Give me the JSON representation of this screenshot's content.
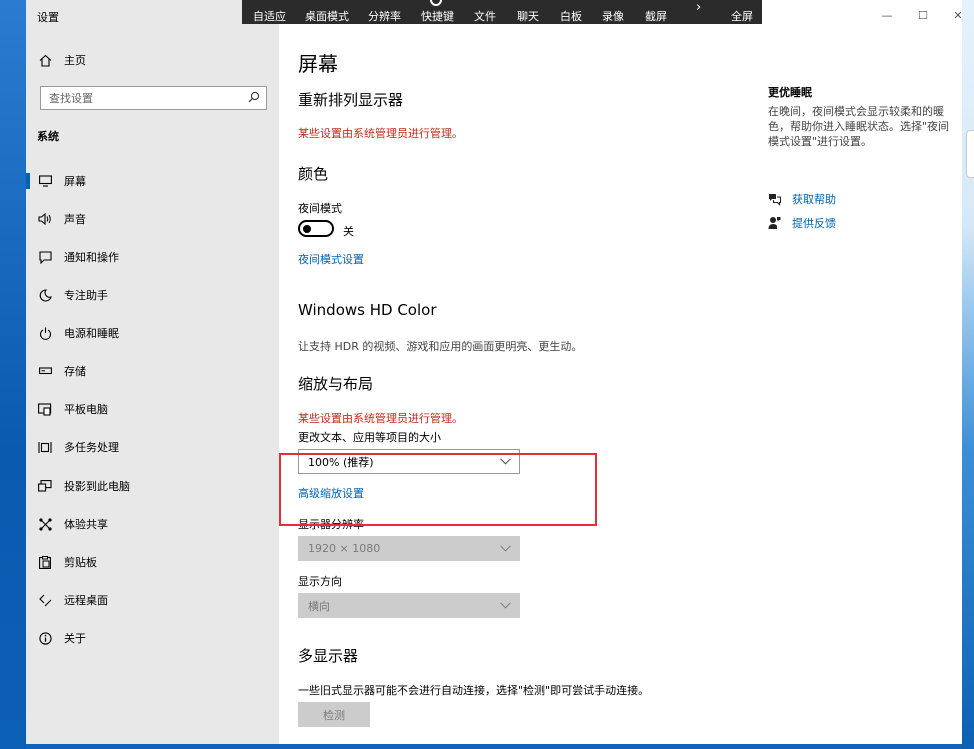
{
  "window": {
    "title": "设置",
    "controls": {
      "minimize": "—",
      "maximize": "☐",
      "close": "✕"
    }
  },
  "toolbar": {
    "items": [
      "自适应",
      "桌面模式",
      "分辨率",
      "快捷键",
      "文件",
      "聊天",
      "白板",
      "录像",
      "截屏",
      "全屏"
    ],
    "more_glyph": "›"
  },
  "sidebar": {
    "home": {
      "label": "主页",
      "icon": "home-icon"
    },
    "search": {
      "placeholder": "查找设置",
      "icon": "search-icon"
    },
    "section": "系统",
    "items": [
      {
        "label": "屏幕",
        "icon": "monitor-icon",
        "selected": true
      },
      {
        "label": "声音",
        "icon": "speaker-icon"
      },
      {
        "label": "通知和操作",
        "icon": "notification-icon"
      },
      {
        "label": "专注助手",
        "icon": "moon-icon"
      },
      {
        "label": "电源和睡眠",
        "icon": "power-icon"
      },
      {
        "label": "存储",
        "icon": "storage-icon"
      },
      {
        "label": "平板电脑",
        "icon": "tablet-icon"
      },
      {
        "label": "多任务处理",
        "icon": "multitask-icon"
      },
      {
        "label": "投影到此电脑",
        "icon": "project-icon"
      },
      {
        "label": "体验共享",
        "icon": "share-icon"
      },
      {
        "label": "剪贴板",
        "icon": "clipboard-icon"
      },
      {
        "label": "远程桌面",
        "icon": "remote-icon"
      },
      {
        "label": "关于",
        "icon": "info-icon"
      }
    ]
  },
  "main": {
    "page_title": "屏幕",
    "rearrange": {
      "heading": "重新排列显示器",
      "managed_warning": "某些设置由系统管理员进行管理。"
    },
    "color": {
      "heading": "颜色",
      "night_light_label": "夜间模式",
      "night_light_state": "关",
      "night_light_settings_link": "夜间模式设置"
    },
    "hdr": {
      "heading": "Windows HD Color",
      "description": "让支持 HDR 的视频、游戏和应用的画面更明亮、更生动。"
    },
    "scale": {
      "heading": "缩放与布局",
      "managed_warning": "某些设置由系统管理员进行管理。",
      "size_label": "更改文本、应用等项目的大小",
      "size_value": "100% (推荐)",
      "advanced_link": "高级缩放设置",
      "resolution_label": "显示器分辨率",
      "resolution_value": "1920 × 1080",
      "orientation_label": "显示方向",
      "orientation_value": "横向"
    },
    "multi": {
      "heading": "多显示器",
      "description": "一些旧式显示器可能不会进行自动连接，选择\"检测\"即可尝试手动连接。",
      "detect_button": "检测"
    }
  },
  "related": {
    "title": "更优睡眠",
    "description": "在晚间，夜间模式会显示较柔和的暖色，帮助你进入睡眠状态。选择\"夜间模式设置\"进行设置。",
    "get_help": "获取帮助",
    "feedback": "提供反馈"
  },
  "colors": {
    "accent": "#0063b1",
    "warning": "#c42b1c",
    "highlight_box": "#e0303b",
    "sidebar_bg": "#e8e8e8"
  }
}
